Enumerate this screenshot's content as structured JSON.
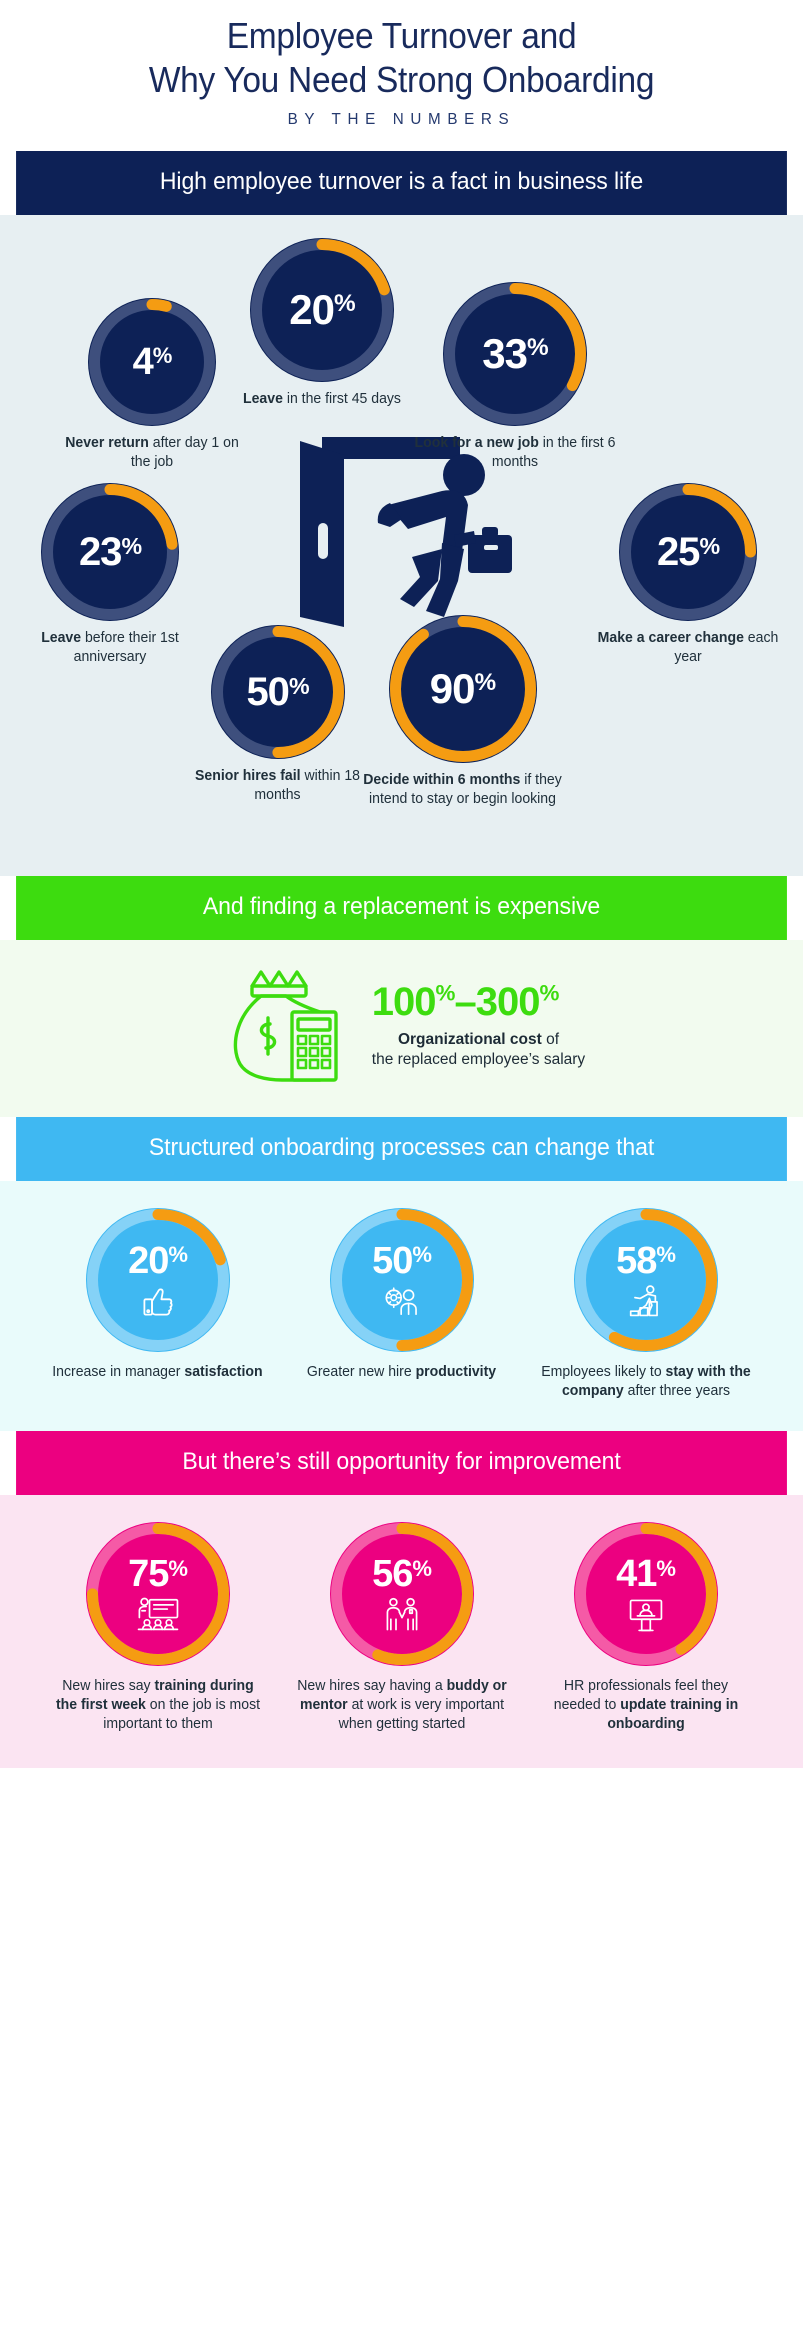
{
  "title": {
    "line1": "Employee Turnover and",
    "line2": "Why You Need Strong Onboarding",
    "subtitle": "BY THE NUMBERS"
  },
  "colors": {
    "navy": "#0d2156",
    "navy_track": "#3e4f7d",
    "orange": "#f59c12",
    "green": "#3ddc0f",
    "blue": "#3fb8f2",
    "blue_track": "#85d2f7",
    "pink": "#ec0080",
    "pink_track": "#f55aa6",
    "panel_navy_bg": "#e7eff2",
    "panel_green_bg": "#f2fbef",
    "panel_blue_bg": "#e9fbfb",
    "panel_pink_bg": "#fbe4f2"
  },
  "section_turnover": {
    "banner": "High employee turnover is a fact in business life",
    "illustration": "person-leaving-door-icon",
    "stats": [
      {
        "value": "4",
        "unit": "%",
        "pct": 4,
        "caption_bold": "Never return",
        "caption_rest": " after day 1 on the job"
      },
      {
        "value": "20",
        "unit": "%",
        "pct": 20,
        "caption_bold": "Leave",
        "caption_rest": " in the first 45 days"
      },
      {
        "value": "33",
        "unit": "%",
        "pct": 33,
        "caption_bold": "Look for a new job",
        "caption_rest": " in the first 6 months"
      },
      {
        "value": "23",
        "unit": "%",
        "pct": 23,
        "caption_bold": "Leave",
        "caption_rest": " before their 1st anniversary"
      },
      {
        "value": "25",
        "unit": "%",
        "pct": 25,
        "caption_bold": "Make a career change",
        "caption_rest": " each year"
      },
      {
        "value": "50",
        "unit": "%",
        "pct": 50,
        "caption_bold": "Senior hires fail",
        "caption_rest": " within 18 months"
      },
      {
        "value": "90",
        "unit": "%",
        "pct": 90,
        "caption_bold": "Decide within 6 months",
        "caption_rest": " if they intend to stay or begin looking"
      }
    ]
  },
  "section_cost": {
    "banner": "And finding a replacement is expensive",
    "icon": "money-bag-calculator-icon",
    "figure_low": "100",
    "figure_low_unit": "%",
    "dash": "–",
    "figure_high": "300",
    "figure_high_unit": "%",
    "text_bold": "Organizational cost",
    "text_rest": " of",
    "text_line2": "the replaced employee’s salary"
  },
  "section_onboarding": {
    "banner": "Structured onboarding processes can change that",
    "stats": [
      {
        "value": "20",
        "unit": "%",
        "pct": 20,
        "icon": "thumbs-up-icon",
        "caption_rest": "Increase in manager ",
        "caption_bold": "satisfaction"
      },
      {
        "value": "50",
        "unit": "%",
        "pct": 50,
        "icon": "person-gear-icon",
        "caption_rest": "Greater new hire ",
        "caption_bold": "productivity"
      },
      {
        "value": "58",
        "unit": "%",
        "pct": 58,
        "icon": "person-climbing-stairs-icon",
        "caption_rest": "Employees likely to ",
        "caption_bold": "stay with the company",
        "caption_tail": " after three years"
      }
    ]
  },
  "section_improvement": {
    "banner": "But there’s still opportunity for improvement",
    "stats": [
      {
        "value": "75",
        "unit": "%",
        "pct": 75,
        "icon": "training-presentation-icon",
        "caption_rest": "New hires say ",
        "caption_bold": "training during the first week",
        "caption_tail": " on the job is most important to them"
      },
      {
        "value": "56",
        "unit": "%",
        "pct": 56,
        "icon": "two-people-handshake-icon",
        "caption_rest": "New hires say having a ",
        "caption_bold": "buddy or mentor",
        "caption_tail": " at work is very important when getting started"
      },
      {
        "value": "41",
        "unit": "%",
        "pct": 41,
        "icon": "person-podium-icon",
        "caption_rest": "HR professionals feel they needed to ",
        "caption_bold": "update training in onboarding",
        "caption_tail": ""
      }
    ]
  },
  "chart_data": {
    "type": "pie",
    "title": "Employee Turnover and Why You Need Strong Onboarding — By The Numbers",
    "note": "Seven navy donut gauges (turnover), three blue donut gauges (onboarding benefit), three pink donut gauges (improvement opportunity). Each gauge shows a single percentage of 100.",
    "series": [
      {
        "name": "High employee turnover is a fact in business life",
        "categories": [
          "Never return after day 1 on the job",
          "Leave in the first 45 days",
          "Look for a new job in the first 6 months",
          "Leave before their 1st anniversary",
          "Make a career change each year",
          "Senior hires fail within 18 months",
          "Decide within 6 months if they intend to stay or begin looking"
        ],
        "values": [
          4,
          20,
          33,
          23,
          25,
          50,
          90
        ]
      },
      {
        "name": "Structured onboarding processes can change that",
        "categories": [
          "Increase in manager satisfaction",
          "Greater new hire productivity",
          "Employees likely to stay with the company after three years"
        ],
        "values": [
          20,
          50,
          58
        ]
      },
      {
        "name": "But there's still opportunity for improvement",
        "categories": [
          "New hires say training during the first week on the job is most important to them",
          "New hires say having a buddy or mentor at work is very important when getting started",
          "HR professionals feel they needed to update training in onboarding"
        ],
        "values": [
          75,
          56,
          41
        ]
      }
    ],
    "annotations": [
      {
        "label": "Organizational cost of the replaced employee's salary",
        "range": [
          100,
          300
        ],
        "unit": "%"
      }
    ],
    "ylim": [
      0,
      100
    ],
    "ylabel": "Percent",
    "xlabel": "",
    "grid": false,
    "legend": "none"
  }
}
